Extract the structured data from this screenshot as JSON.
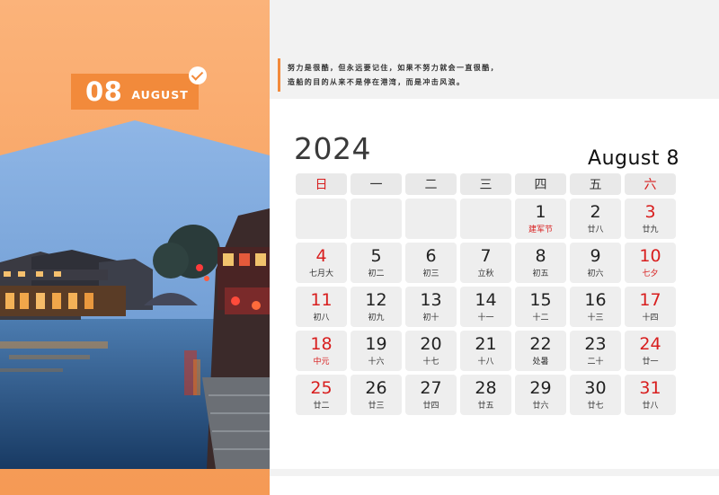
{
  "cover": {
    "month_number": "08",
    "month_name": "AUGUST",
    "check_icon": "check-circle-icon"
  },
  "quote": {
    "line1": "努力是很酷，但永远要记住，如果不努力就会一直很酷，",
    "line2": "造船的目的从来不是停在港湾，而是冲击风浪。"
  },
  "calendar": {
    "year": "2024",
    "month_title": "August 8",
    "weekdays": [
      "日",
      "一",
      "二",
      "三",
      "四",
      "五",
      "六"
    ],
    "weeks": [
      [
        {
          "num": "",
          "lunar": ""
        },
        {
          "num": "",
          "lunar": ""
        },
        {
          "num": "",
          "lunar": ""
        },
        {
          "num": "",
          "lunar": ""
        },
        {
          "num": "1",
          "lunar": "建军节",
          "lunar_red": true
        },
        {
          "num": "2",
          "lunar": "廿八"
        },
        {
          "num": "3",
          "lunar": "廿九"
        }
      ],
      [
        {
          "num": "4",
          "lunar": "七月大"
        },
        {
          "num": "5",
          "lunar": "初二"
        },
        {
          "num": "6",
          "lunar": "初三"
        },
        {
          "num": "7",
          "lunar": "立秋"
        },
        {
          "num": "8",
          "lunar": "初五"
        },
        {
          "num": "9",
          "lunar": "初六"
        },
        {
          "num": "10",
          "lunar": "七夕",
          "lunar_red": true
        }
      ],
      [
        {
          "num": "11",
          "lunar": "初八"
        },
        {
          "num": "12",
          "lunar": "初九"
        },
        {
          "num": "13",
          "lunar": "初十"
        },
        {
          "num": "14",
          "lunar": "十一"
        },
        {
          "num": "15",
          "lunar": "十二"
        },
        {
          "num": "16",
          "lunar": "十三"
        },
        {
          "num": "17",
          "lunar": "十四"
        }
      ],
      [
        {
          "num": "18",
          "lunar": "中元",
          "lunar_red": true
        },
        {
          "num": "19",
          "lunar": "十六"
        },
        {
          "num": "20",
          "lunar": "十七"
        },
        {
          "num": "21",
          "lunar": "十八"
        },
        {
          "num": "22",
          "lunar": "处暑"
        },
        {
          "num": "23",
          "lunar": "二十"
        },
        {
          "num": "24",
          "lunar": "廿一"
        }
      ],
      [
        {
          "num": "25",
          "lunar": "廿二"
        },
        {
          "num": "26",
          "lunar": "廿三"
        },
        {
          "num": "27",
          "lunar": "廿四"
        },
        {
          "num": "28",
          "lunar": "廿五"
        },
        {
          "num": "29",
          "lunar": "廿六"
        },
        {
          "num": "30",
          "lunar": "廿七"
        },
        {
          "num": "31",
          "lunar": "廿八"
        }
      ]
    ]
  },
  "colors": {
    "accent": "#f28a3b",
    "weekend": "#d81e1e",
    "cell_bg": "#eeeeee"
  }
}
